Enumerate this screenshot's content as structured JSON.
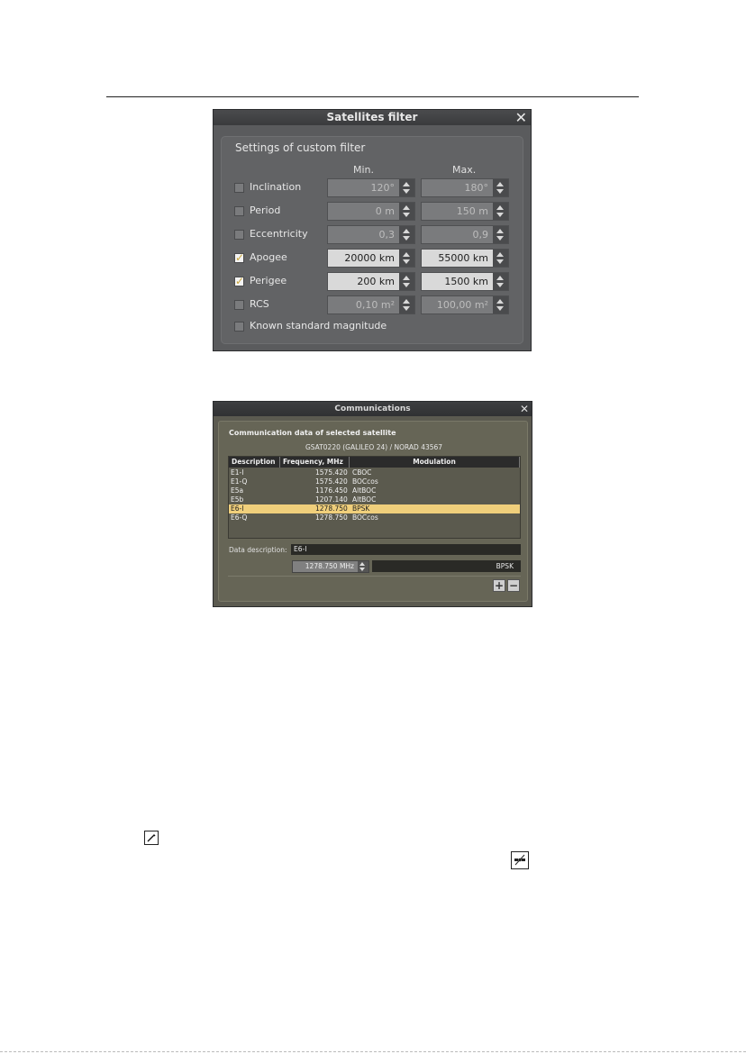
{
  "filter_dialog": {
    "title": "Satellites filter",
    "close_glyph": "✕",
    "heading": "Settings of custom filter",
    "col_min": "Min.",
    "col_max": "Max.",
    "rows": [
      {
        "label": "Inclination",
        "checked": false,
        "min": "120°",
        "max": "180°"
      },
      {
        "label": "Period",
        "checked": false,
        "min": "0 m",
        "max": "150 m"
      },
      {
        "label": "Eccentricity",
        "checked": false,
        "min": "0,3",
        "max": "0,9"
      },
      {
        "label": "Apogee",
        "checked": true,
        "min": "20000 km",
        "max": "55000 km"
      },
      {
        "label": "Perigee",
        "checked": true,
        "min": "200 km",
        "max": "1500 km"
      },
      {
        "label": "RCS",
        "checked": false,
        "min": "0,10 m²",
        "max": "100,00 m²"
      }
    ],
    "known_magnitude": {
      "label": "Known standard magnitude",
      "checked": false
    }
  },
  "comm_dialog": {
    "title": "Communications",
    "close_glyph": "✕",
    "heading": "Communication data of selected satellite",
    "satellite": "GSAT0220 (GALILEO 24) / NORAD 43567",
    "columns": [
      "Description",
      "Frequency, MHz",
      "Modulation"
    ],
    "rows": [
      {
        "desc": "E1-I",
        "freq": "1575.420",
        "mod": "CBOC",
        "selected": false
      },
      {
        "desc": "E1-Q",
        "freq": "1575.420",
        "mod": "BOCcos",
        "selected": false
      },
      {
        "desc": "E5a",
        "freq": "1176.450",
        "mod": "AltBOC",
        "selected": false
      },
      {
        "desc": "E5b",
        "freq": "1207.140",
        "mod": "AltBOC",
        "selected": false
      },
      {
        "desc": "E6-I",
        "freq": "1278.750",
        "mod": "BPSK",
        "selected": true
      },
      {
        "desc": "E6-Q",
        "freq": "1278.750",
        "mod": "BOCcos",
        "selected": false
      }
    ],
    "data_description_label": "Data description:",
    "data_description_value": "E6-I",
    "frequency_value": "1278.750 MHz",
    "modulation_value": "BPSK",
    "add_glyph": "+",
    "remove_glyph": "−"
  },
  "icons": {
    "wrench": "wrench-icon",
    "satellite": "satellite-icon"
  }
}
